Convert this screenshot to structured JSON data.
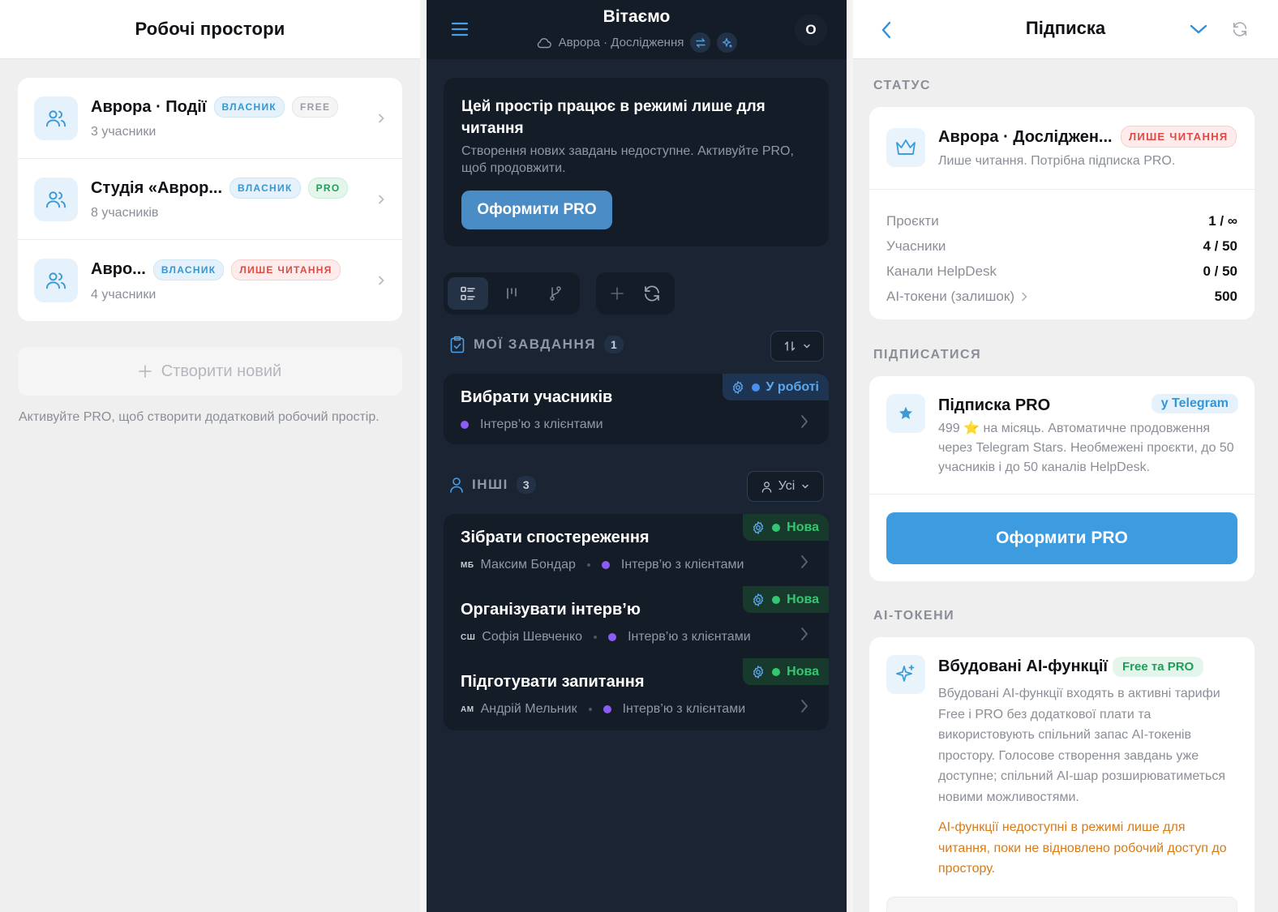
{
  "left": {
    "title": "Робочі простори",
    "workspaces": [
      {
        "name": "Аврора · Події",
        "members": "3 учасники",
        "badges": [
          "ВЛАСНИК",
          "FREE"
        ]
      },
      {
        "name": "Студія «Аврор...",
        "members": "8 учасників",
        "badges": [
          "ВЛАСНИК",
          "PRO"
        ]
      },
      {
        "name": "Авро...",
        "members": "4 учасники",
        "badges": [
          "ВЛАСНИК",
          "ЛИШЕ ЧИТАННЯ"
        ]
      }
    ],
    "create_label": "Створити новий",
    "hint": "Активуйте PRO, щоб створити додатковий робочий простір."
  },
  "mid": {
    "title": "Вітаємо",
    "subtitle": "Аврора · Дослідження",
    "avatar": "О",
    "readonly_title": "Цей простір працює в режимі лише для читання",
    "readonly_text": "Створення нових завдань недоступне. Активуйте PRO, щоб продовжити.",
    "pro_button": "Оформити PRO",
    "my_tasks": {
      "label": "МОЇ ЗАВДАННЯ",
      "count": "1",
      "items": [
        {
          "title": "Вибрати учасників",
          "project": "Інтерв’ю з клієнтами",
          "status": "У роботі"
        }
      ]
    },
    "others": {
      "label": "ІНШІ",
      "count": "3",
      "filter": "Усі",
      "items": [
        {
          "title": "Зібрати спостереження",
          "initials": "МБ",
          "assignee": "Максим Бондар",
          "project": "Інтерв’ю з клієнтами",
          "status": "Нова"
        },
        {
          "title": "Організувати інтерв’ю",
          "initials": "СШ",
          "assignee": "Софія Шевченко",
          "project": "Інтерв’ю з клієнтами",
          "status": "Нова"
        },
        {
          "title": "Підготувати запитання",
          "initials": "АМ",
          "assignee": "Андрій Мельник",
          "project": "Інтерв’ю з клієнтами",
          "status": "Нова"
        }
      ]
    }
  },
  "right": {
    "title": "Підписка",
    "status_label": "СТАТУС",
    "workspace_name": "Аврора · Досліджен...",
    "workspace_badge": "ЛИШЕ ЧИТАННЯ",
    "workspace_sub": "Лише читання. Потрібна підписка PRO.",
    "limits": [
      {
        "label": "Проєкти",
        "value": "1 / ∞"
      },
      {
        "label": "Учасники",
        "value": "4 / 50"
      },
      {
        "label": "Канали HelpDesk",
        "value": "0 / 50"
      },
      {
        "label": "AI-токени (залишок)",
        "value": "500"
      }
    ],
    "subscribe_label": "ПІДПИСАТИСЯ",
    "plan_name": "Підписка PRO",
    "plan_badge": "у Telegram",
    "plan_desc": "499 ⭐ на місяць. Автоматичне продовження через Telegram Stars. Необмежені проєкти, до 50 учасників і до 50 каналів HelpDesk.",
    "plan_button": "Оформити PRO",
    "ai_label": "AI-ТОКЕНИ",
    "ai_name": "Вбудовані AI-функції",
    "ai_badge": "Free та PRO",
    "ai_desc": "Вбудовані AI-функції входять в активні тарифи Free і PRO без додаткової плати та використовують спільний запас AI-токенів простору. Голосове створення завдань уже доступне; спільний AI-шар розширюватиметься новими можливостями.",
    "ai_warning": "AI-функції недоступні в режимі лише для читання, поки не відновлено робочий доступ до простору."
  },
  "colors": {
    "accent": "#3d9be0",
    "dark_bg": "#1b2432",
    "status_in_progress": "#5ea8ee",
    "status_new": "#34c76f",
    "project_dot": "#8b5cf6",
    "warning": "#d97a14"
  }
}
